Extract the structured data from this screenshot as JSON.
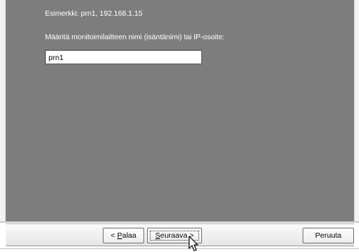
{
  "dialog": {
    "example_text": "Esimerkki: prn1, 192.168.1.15",
    "prompt_label": "Määritä monitoimilaitteen nimi (isäntänimi) tai IP-osoite:",
    "host_input_value": "prn1"
  },
  "buttons": {
    "back_mnemonic": "P",
    "back_prefix": "< ",
    "back_rest": "alaa",
    "next_mnemonic": "S",
    "next_rest": "euraava",
    "next_suffix": " >",
    "cancel_label": "Peruuta"
  },
  "colors": {
    "panel_background": "#7d7d7d",
    "panel_text": "#ffffff"
  },
  "icons": {
    "pointer": "mouse-pointer-icon"
  }
}
